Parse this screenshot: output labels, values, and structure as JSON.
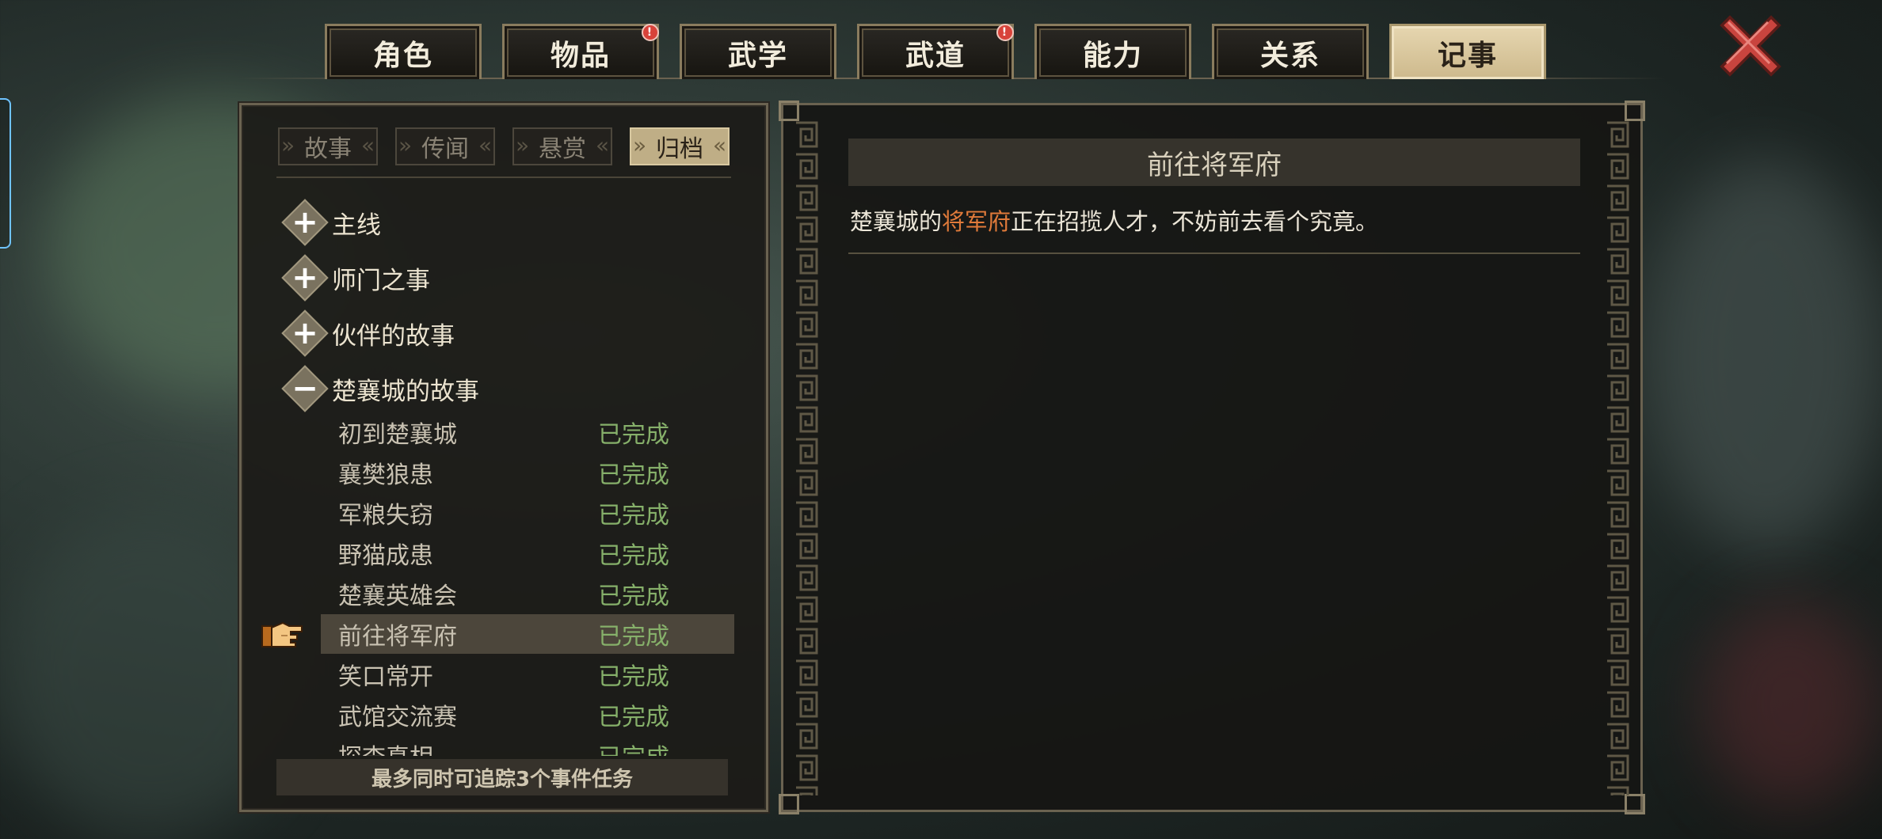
{
  "top_tabs": [
    {
      "label": "角色",
      "badge": false
    },
    {
      "label": "物品",
      "badge": true
    },
    {
      "label": "武学",
      "badge": false
    },
    {
      "label": "武道",
      "badge": true
    },
    {
      "label": "能力",
      "badge": false
    },
    {
      "label": "关系",
      "badge": false
    },
    {
      "label": "记事",
      "badge": false,
      "active": true
    }
  ],
  "badge_mark": "!",
  "sub_tabs": [
    {
      "label": "故事"
    },
    {
      "label": "传闻"
    },
    {
      "label": "悬赏"
    },
    {
      "label": "归档",
      "active": true
    }
  ],
  "categories": [
    {
      "label": "主线",
      "expanded": false,
      "symbol": "+"
    },
    {
      "label": "师门之事",
      "expanded": false,
      "symbol": "+"
    },
    {
      "label": "伙伴的故事",
      "expanded": false,
      "symbol": "+"
    },
    {
      "label": "楚襄城的故事",
      "expanded": true,
      "symbol": "−"
    }
  ],
  "quests": [
    {
      "name": "初到楚襄城",
      "status": "已完成"
    },
    {
      "name": "襄樊狼患",
      "status": "已完成"
    },
    {
      "name": "军粮失窃",
      "status": "已完成"
    },
    {
      "name": "野猫成患",
      "status": "已完成"
    },
    {
      "name": "楚襄英雄会",
      "status": "已完成"
    },
    {
      "name": "前往将军府",
      "status": "已完成",
      "selected": true
    },
    {
      "name": "笑口常开",
      "status": "已完成"
    },
    {
      "name": "武馆交流赛",
      "status": "已完成"
    },
    {
      "name": "探查真相",
      "status": "已完成"
    }
  ],
  "footer": "最多同时可追踪3个事件任务",
  "detail": {
    "title": "前往将军府",
    "text_before": "楚襄城的",
    "highlight": "将军府",
    "text_after": "正在招揽人才，不妨前去看个究竟。"
  },
  "colors": {
    "status_done": "#86b06a",
    "highlight": "#e07a3a",
    "active_tab": "#cdb98c",
    "close_x": "#c9443e"
  },
  "icons": {
    "close": "close-x-icon",
    "pointer": "pointing-hand-icon",
    "expand": "plus-icon",
    "collapse": "minus-icon"
  }
}
